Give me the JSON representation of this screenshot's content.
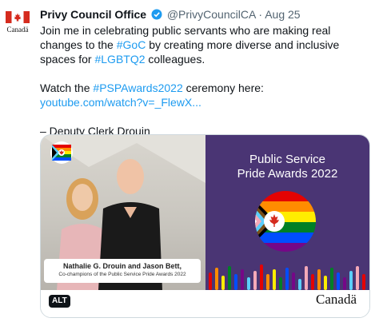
{
  "avatar": {
    "wordmark": "Canadä"
  },
  "tweet": {
    "display_name": "Privy Council Office",
    "handle": "@PrivyCouncilCA",
    "separator": "·",
    "date": "Aug 25",
    "text_1": "Join me in celebrating public servants who are making real changes to the ",
    "hashtag_goc": "#GoC",
    "text_2": " by creating more diverse and inclusive spaces for ",
    "hashtag_lgbtq2": "#LGBTQ2",
    "text_3": " colleagues.",
    "watch_text": "Watch the ",
    "hashtag_awards": "#PSPAwards2022",
    "watch_text_2": " ceremony here:",
    "link": "youtube.com/watch?v=_FlewX...",
    "signature": "– Deputy Clerk Drouin"
  },
  "media": {
    "title_line1": "Public Service",
    "title_line2": "Pride Awards 2022",
    "caption_names": "Nathalie G. Drouin and Jason Bett,",
    "caption_role": "Co-champions of the Public Service Pride Awards 2022",
    "alt_badge": "ALT",
    "wordmark": "Canadä"
  },
  "colors": {
    "link": "#1d9bf0",
    "panel": "#4a3574",
    "flag_red": "#d52b1e"
  }
}
